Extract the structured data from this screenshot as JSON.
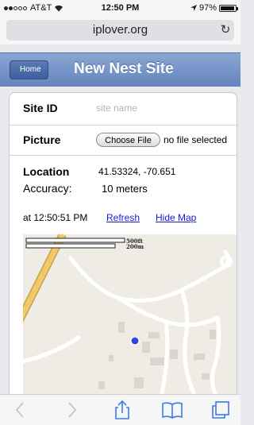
{
  "status": {
    "carrier": "AT&T",
    "time": "12:50 PM",
    "battery": "97%",
    "battery_level": 0.97
  },
  "browser": {
    "url": "iplover.org"
  },
  "nav": {
    "back_label": "Home",
    "title": "New Nest Site"
  },
  "form": {
    "site_id_label": "Site ID",
    "site_id_placeholder": "site name",
    "picture_label": "Picture",
    "choose_file_label": "Choose File",
    "no_file_text": "no file selected",
    "location_label": "Location",
    "location_value": "41.53324, -70.651",
    "accuracy_label": "Accuracy:",
    "accuracy_value": "10 meters",
    "timestamp": "at 12:50:51 PM",
    "refresh_label": "Refresh",
    "hide_map_label": "Hide Map"
  },
  "map": {
    "scale_top": "500ft",
    "scale_bottom": "200m",
    "marker_color": "#3344dd"
  },
  "toolbar": {
    "icons": [
      "back-arrow-icon",
      "forward-arrow-icon",
      "share-icon",
      "bookmarks-icon",
      "tabs-icon"
    ]
  }
}
